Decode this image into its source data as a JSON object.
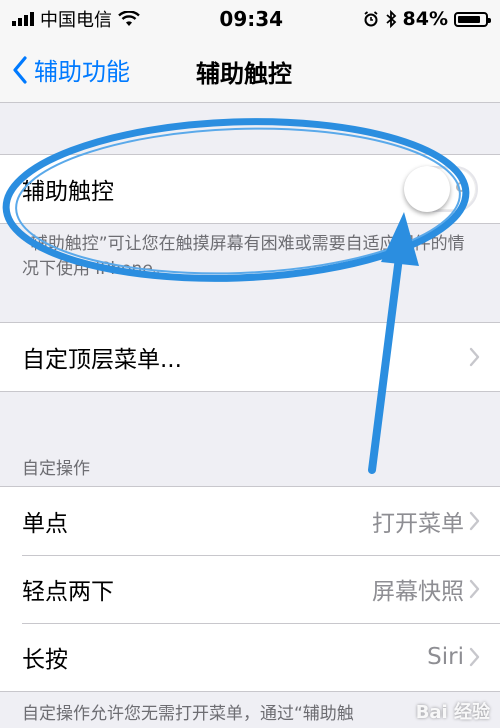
{
  "status_bar": {
    "carrier": "中国电信",
    "time": "09:34",
    "battery": "84%",
    "battery_level": 0.84
  },
  "nav": {
    "back_label": "辅助功能",
    "title": "辅助触控"
  },
  "assistive_touch": {
    "label": "辅助触控",
    "toggle_on": false,
    "description": "“辅助触控”可让您在触摸屏幕有困难或需要自适应配件的情况下使用 iPhone。"
  },
  "customize_top": {
    "label": "自定顶层菜单..."
  },
  "custom_actions": {
    "header": "自定操作",
    "rows": [
      {
        "label": "单点",
        "value": "打开菜单"
      },
      {
        "label": "轻点两下",
        "value": "屏幕快照"
      },
      {
        "label": "长按",
        "value": "Siri"
      }
    ],
    "footer": "自定操作允许您无需打开菜单，通过“辅助触"
  },
  "icons": {
    "back": "chevron-left-icon",
    "chevron": "chevron-right-icon",
    "wifi": "wifi-icon",
    "signal": "cellular-signal-icon",
    "alarm": "alarm-icon",
    "bluetooth": "bluetooth-icon",
    "battery": "battery-icon"
  },
  "colors": {
    "accent": "#007aff",
    "annotation": "#2b8ee0",
    "background": "#efeff4"
  },
  "watermark": "Bai 经验"
}
